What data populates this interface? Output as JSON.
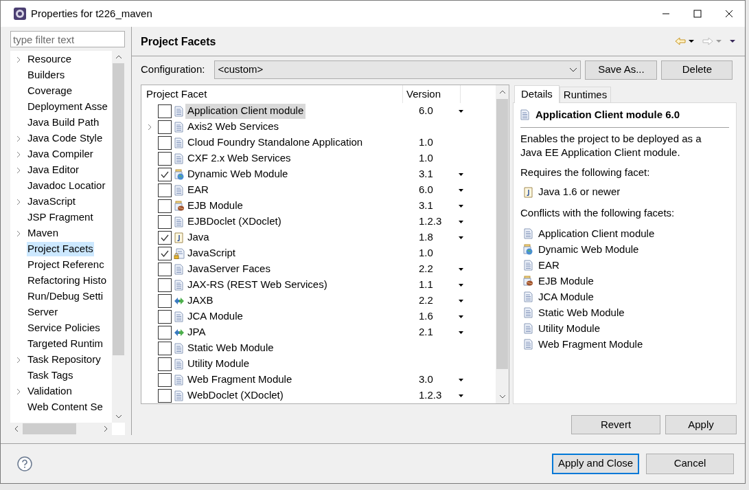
{
  "window": {
    "title": "Properties for t226_maven"
  },
  "filter": {
    "placeholder": "type filter text"
  },
  "sidebar": {
    "items": [
      {
        "label": "Resource",
        "expandable": true,
        "selected": false
      },
      {
        "label": "Builders",
        "expandable": false,
        "selected": false
      },
      {
        "label": "Coverage",
        "expandable": false,
        "selected": false
      },
      {
        "label": "Deployment Asse",
        "expandable": false,
        "selected": false
      },
      {
        "label": "Java Build Path",
        "expandable": false,
        "selected": false
      },
      {
        "label": "Java Code Style",
        "expandable": true,
        "selected": false
      },
      {
        "label": "Java Compiler",
        "expandable": true,
        "selected": false
      },
      {
        "label": "Java Editor",
        "expandable": true,
        "selected": false
      },
      {
        "label": "Javadoc Locatior",
        "expandable": false,
        "selected": false
      },
      {
        "label": "JavaScript",
        "expandable": true,
        "selected": false
      },
      {
        "label": "JSP Fragment",
        "expandable": false,
        "selected": false
      },
      {
        "label": "Maven",
        "expandable": true,
        "selected": false
      },
      {
        "label": "Project Facets",
        "expandable": false,
        "selected": true
      },
      {
        "label": "Project Referenc",
        "expandable": false,
        "selected": false
      },
      {
        "label": "Refactoring Histo",
        "expandable": false,
        "selected": false
      },
      {
        "label": "Run/Debug Setti",
        "expandable": false,
        "selected": false
      },
      {
        "label": "Server",
        "expandable": false,
        "selected": false
      },
      {
        "label": "Service Policies",
        "expandable": false,
        "selected": false
      },
      {
        "label": "Targeted Runtim",
        "expandable": false,
        "selected": false
      },
      {
        "label": "Task Repository",
        "expandable": true,
        "selected": false
      },
      {
        "label": "Task Tags",
        "expandable": false,
        "selected": false
      },
      {
        "label": "Validation",
        "expandable": true,
        "selected": false
      },
      {
        "label": "Web Content Se",
        "expandable": false,
        "selected": false
      }
    ]
  },
  "page": {
    "title": "Project Facets",
    "configuration_label": "Configuration:",
    "configuration_value": "<custom>",
    "buttons": [
      "Save As...",
      "Delete"
    ]
  },
  "table": {
    "columns": [
      "Project Facet",
      "Version"
    ],
    "rows": [
      {
        "name": "Application Client module",
        "kind": "doc",
        "checked": false,
        "expandable": false,
        "selected": true,
        "version": "6.0",
        "dropdown": true
      },
      {
        "name": "Axis2 Web Services",
        "kind": "doc",
        "checked": false,
        "expandable": true,
        "selected": false
      },
      {
        "name": "Cloud Foundry Standalone Application",
        "kind": "doc",
        "checked": false,
        "expandable": false,
        "selected": false,
        "version": "1.0",
        "dropdown": false
      },
      {
        "name": "CXF 2.x Web Services",
        "kind": "doc",
        "checked": false,
        "expandable": false,
        "selected": false,
        "version": "1.0",
        "dropdown": false
      },
      {
        "name": "Dynamic Web Module",
        "kind": "web",
        "checked": true,
        "expandable": false,
        "selected": false,
        "version": "3.1",
        "dropdown": true
      },
      {
        "name": "EAR",
        "kind": "doc",
        "checked": false,
        "expandable": false,
        "selected": false,
        "version": "6.0",
        "dropdown": true
      },
      {
        "name": "EJB Module",
        "kind": "bean",
        "checked": false,
        "expandable": false,
        "selected": false,
        "version": "3.1",
        "dropdown": true
      },
      {
        "name": "EJBDoclet (XDoclet)",
        "kind": "doc",
        "checked": false,
        "expandable": false,
        "selected": false,
        "version": "1.2.3",
        "dropdown": true
      },
      {
        "name": "Java",
        "kind": "java",
        "checked": true,
        "expandable": false,
        "selected": false,
        "version": "1.8",
        "dropdown": true
      },
      {
        "name": "JavaScript",
        "kind": "script",
        "checked": true,
        "expandable": false,
        "selected": false,
        "version": "1.0",
        "dropdown": false
      },
      {
        "name": "JavaServer Faces",
        "kind": "doc",
        "checked": false,
        "expandable": false,
        "selected": false,
        "version": "2.2",
        "dropdown": true
      },
      {
        "name": "JAX-RS (REST Web Services)",
        "kind": "doc",
        "checked": false,
        "expandable": false,
        "selected": false,
        "version": "1.1",
        "dropdown": true
      },
      {
        "name": "JAXB",
        "kind": "arrows",
        "checked": false,
        "expandable": false,
        "selected": false,
        "version": "2.2",
        "dropdown": true
      },
      {
        "name": "JCA Module",
        "kind": "doc",
        "checked": false,
        "expandable": false,
        "selected": false,
        "version": "1.6",
        "dropdown": true
      },
      {
        "name": "JPA",
        "kind": "arrows",
        "checked": false,
        "expandable": false,
        "selected": false,
        "version": "2.1",
        "dropdown": true
      },
      {
        "name": "Static Web Module",
        "kind": "doc",
        "checked": false,
        "expandable": false,
        "selected": false
      },
      {
        "name": "Utility Module",
        "kind": "doc",
        "checked": false,
        "expandable": false,
        "selected": false
      },
      {
        "name": "Web Fragment Module",
        "kind": "doc",
        "checked": false,
        "expandable": false,
        "selected": false,
        "version": "3.0",
        "dropdown": true
      },
      {
        "name": "WebDoclet (XDoclet)",
        "kind": "doc",
        "checked": false,
        "expandable": false,
        "selected": false,
        "version": "1.2.3",
        "dropdown": true
      }
    ]
  },
  "details": {
    "tabs": [
      {
        "label": "Details",
        "selected": true
      },
      {
        "label": "Runtimes",
        "selected": false
      }
    ],
    "title": "Application Client module 6.0",
    "description": "Enables the project to be deployed as a Java EE Application Client module.",
    "requires_label": "Requires the following facet:",
    "requires": [
      {
        "name": "Java 1.6 or newer",
        "kind": "java"
      }
    ],
    "conflicts_label": "Conflicts with the following facets:",
    "conflicts": [
      {
        "name": "Application Client module",
        "kind": "doc"
      },
      {
        "name": "Dynamic Web Module",
        "kind": "web"
      },
      {
        "name": "EAR",
        "kind": "doc"
      },
      {
        "name": "EJB Module",
        "kind": "bean"
      },
      {
        "name": "JCA Module",
        "kind": "doc"
      },
      {
        "name": "Static Web Module",
        "kind": "doc"
      },
      {
        "name": "Utility Module",
        "kind": "doc"
      },
      {
        "name": "Web Fragment Module",
        "kind": "doc"
      }
    ]
  },
  "page_buttons": [
    "Revert",
    "Apply"
  ],
  "footer_buttons": [
    {
      "label": "Apply and Close",
      "default": true
    },
    {
      "label": "Cancel",
      "default": false
    }
  ]
}
